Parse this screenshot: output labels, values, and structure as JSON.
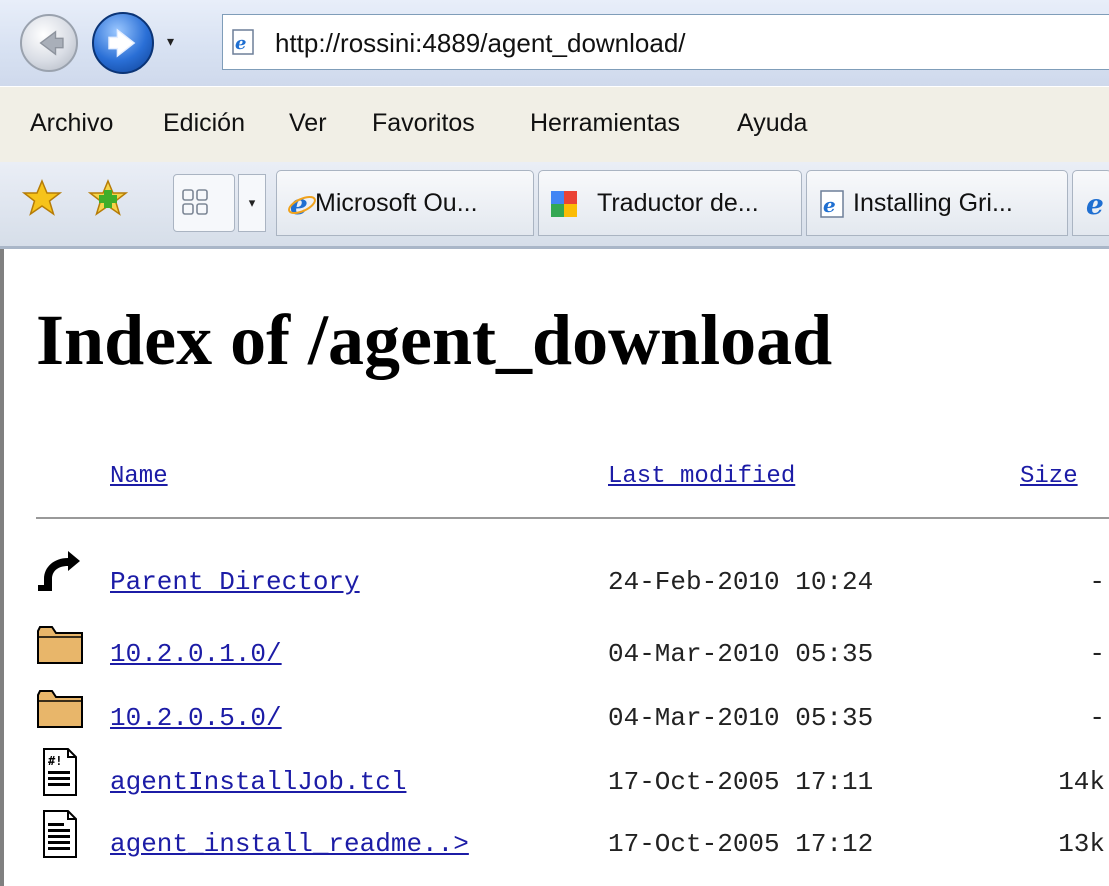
{
  "browser": {
    "address": "http://rossini:4889/agent_download/",
    "history_dropdown": "▾",
    "menu": [
      "Archivo",
      "Edición",
      "Ver",
      "Favoritos",
      "Herramientas",
      "Ayuda"
    ],
    "tabs": [
      {
        "label": "Microsoft Ou...",
        "icon": "ie-icon"
      },
      {
        "label": "Traductor de...",
        "icon": "google-translate-icon"
      },
      {
        "label": "Installing Gri...",
        "icon": "ie-page-icon"
      },
      {
        "label": "",
        "icon": "ie-icon"
      }
    ]
  },
  "page": {
    "title": "Index of /agent_download",
    "columns": {
      "name": "Name",
      "modified": "Last modified",
      "size": "Size"
    },
    "rows": [
      {
        "icon": "back-arrow-icon",
        "name": "Parent Directory",
        "modified": "24-Feb-2010 10:24",
        "size": "-"
      },
      {
        "icon": "folder-icon",
        "name": "10.2.0.1.0/",
        "modified": "04-Mar-2010 05:35",
        "size": "-"
      },
      {
        "icon": "folder-icon",
        "name": "10.2.0.5.0/",
        "modified": "04-Mar-2010 05:35",
        "size": "-"
      },
      {
        "icon": "script-file-icon",
        "name": "agentInstallJob.tcl",
        "modified": "17-Oct-2005 17:11",
        "size": "14k"
      },
      {
        "icon": "text-file-icon",
        "name": "agent_install_readme..>",
        "modified": "17-Oct-2005 17:12",
        "size": "13k"
      }
    ]
  }
}
